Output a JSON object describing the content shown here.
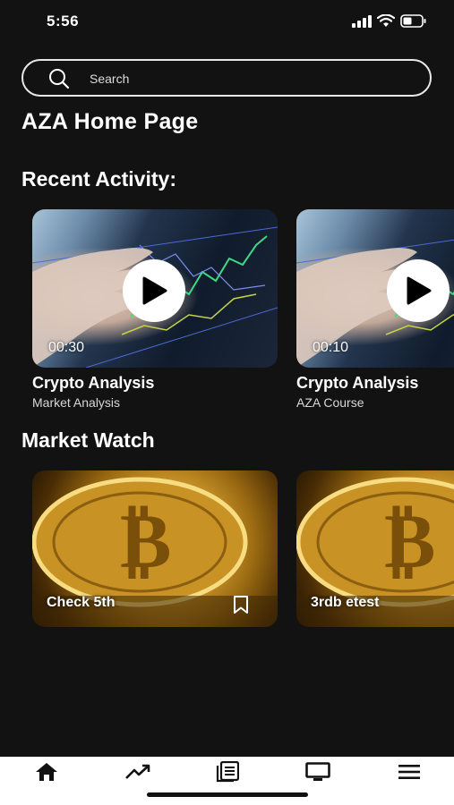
{
  "status_bar": {
    "time": "5:56",
    "icons": [
      "signal-icon",
      "wifi-icon",
      "battery-icon"
    ]
  },
  "search": {
    "placeholder": "Search"
  },
  "page_title": "AZA Home Page",
  "recent_activity": {
    "title": "Recent Activity:",
    "items": [
      {
        "duration": "00:30",
        "title": "Crypto Analysis",
        "subtitle": "Market Analysis",
        "icon": "play-icon"
      },
      {
        "duration": "00:10",
        "title": "Crypto Analysis",
        "subtitle": "AZA Course",
        "icon": "play-icon"
      }
    ]
  },
  "market_watch": {
    "title": "Market Watch",
    "items": [
      {
        "label": "Check 5th",
        "icon": "bookmark-icon"
      },
      {
        "label": "3rdb etest",
        "icon": "bookmark-icon"
      }
    ]
  },
  "bottom_nav": {
    "items": [
      "home-icon",
      "trending-icon",
      "news-icon",
      "monitor-icon",
      "menu-icon"
    ]
  },
  "colors": {
    "background": "#121212",
    "text": "#ffffff",
    "nav_background": "#ffffff",
    "nav_icon": "#111111"
  }
}
